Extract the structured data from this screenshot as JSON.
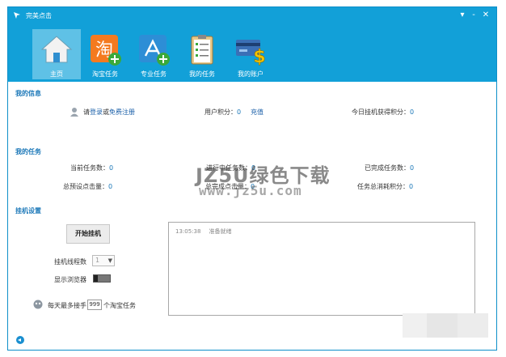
{
  "window": {
    "title": "完美点击",
    "min": "-",
    "restore": "▾",
    "close": "✕"
  },
  "nav": [
    {
      "label": "主页",
      "icon": "home-icon"
    },
    {
      "label": "淘宝任务",
      "icon": "taobao-add-icon"
    },
    {
      "label": "专业任务",
      "icon": "app-add-icon"
    },
    {
      "label": "我的任务",
      "icon": "clipboard-icon"
    },
    {
      "label": "我的账户",
      "icon": "card-dollar-icon"
    }
  ],
  "info": {
    "section": "我的信息",
    "login_prefix": "请",
    "login_link": "登录",
    "or": "或",
    "register_link": "免费注册",
    "points_label": "用户积分：",
    "points_value": "0",
    "recharge": "充值",
    "today_label": "今日挂机获得积分：",
    "today_value": "0"
  },
  "tasks": {
    "section": "我的任务",
    "current_label": "当前任务数：",
    "current_value": "0",
    "running_label": "进行中任务数：",
    "running_value": "0",
    "done_label": "已完成任务数：",
    "done_value": "0",
    "preset_label": "总预设点击量：",
    "preset_value": "0",
    "completed_clicks_label": "总完成点击量：",
    "completed_clicks_value": "0",
    "consumed_label": "任务总消耗积分：",
    "consumed_value": "0"
  },
  "hang": {
    "section": "挂机设置",
    "start_button": "开始挂机",
    "threads_label": "挂机线程数",
    "threads_value": "1",
    "browser_label": "显示浏览器",
    "daily_prefix": "每天最多接手",
    "daily_value": "999",
    "daily_suffix": "个淘宝任务"
  },
  "log": {
    "time": "13:05:38",
    "message": "准备就绪"
  },
  "watermark": {
    "line1": "JZ5U绿色下载",
    "line2": "www.jz5u.com"
  },
  "colors": {
    "accent": "#12a0d8",
    "value": "#1a77b8"
  }
}
